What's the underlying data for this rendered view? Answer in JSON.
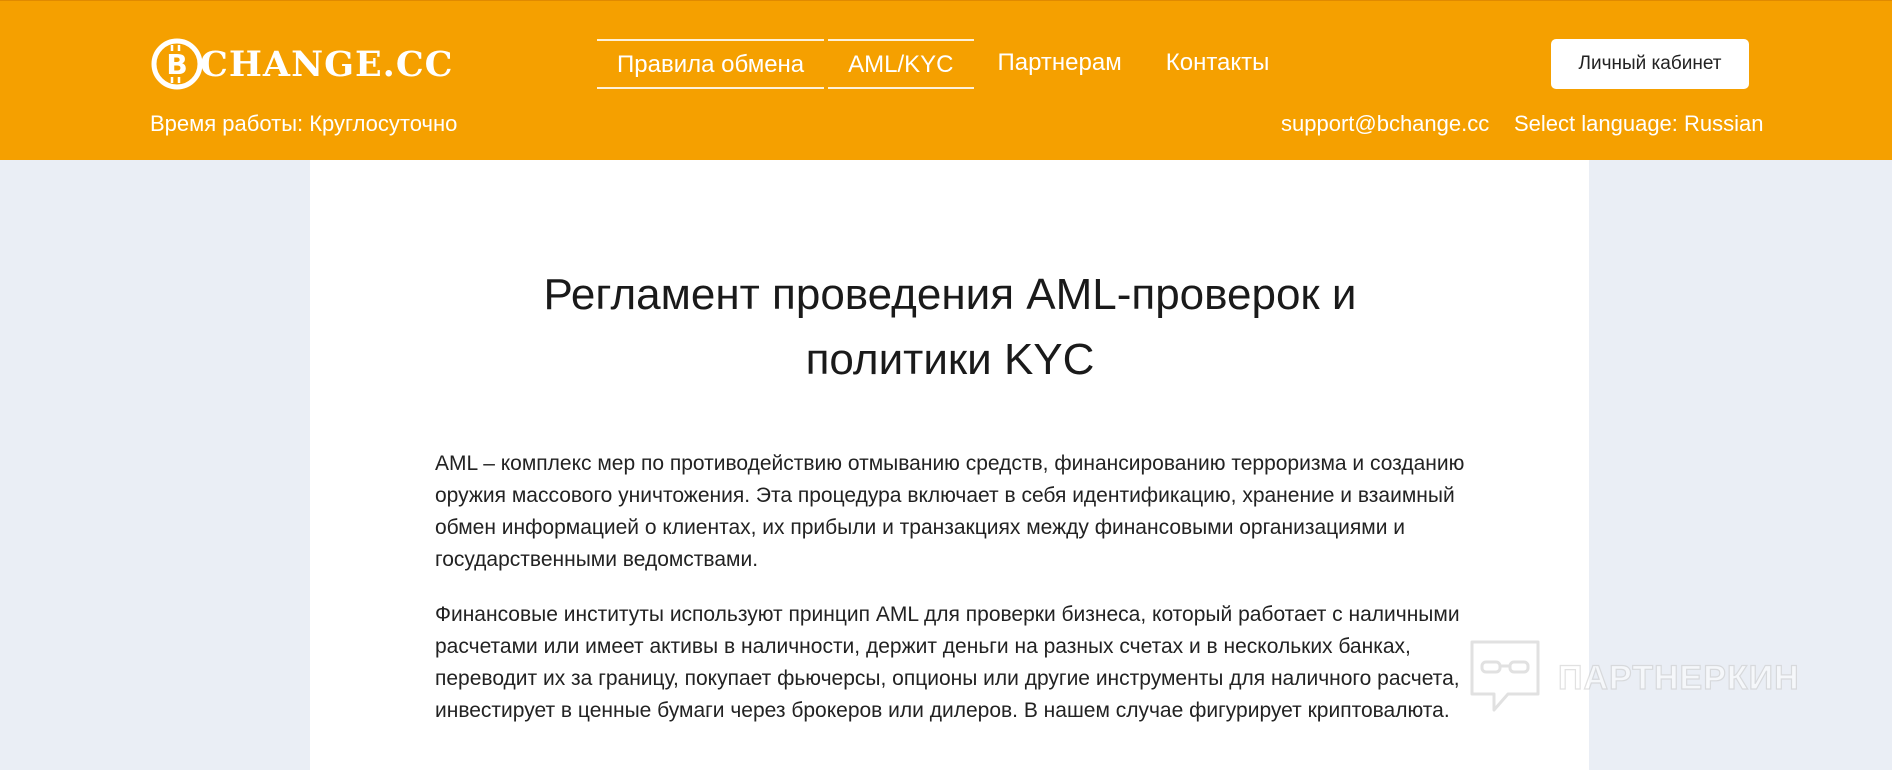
{
  "header": {
    "logo_text": "CHANGE.CC",
    "nav": [
      {
        "label": "Правила обмена"
      },
      {
        "label": "AML/KYC"
      },
      {
        "label": "Партнерам"
      },
      {
        "label": "Контакты"
      }
    ],
    "cabinet_label": "Личный кабинет",
    "work_hours": "Время работы: Круглосуточно",
    "support_email": "support@bchange.cc",
    "language": "Select language: Russian"
  },
  "content": {
    "title_line1": "Регламент проведения AML-проверок и",
    "title_line2": "политики KYC",
    "paragraphs": [
      "AML – комплекс мер по противодействию отмыванию средств, финансированию терроризма и созданию оружия массового уничтожения. Эта процедура включает в себя идентификацию, хранение и взаимный обмен информацией о клиентах, их прибыли и транзакциях между финансовыми организациями и государственными ведомствами.",
      "Финансовые институты используют принцип AML для проверки бизнеса, который работает с наличными расчетами или имеет активы в наличности, держит деньги на разных счетах и в нескольких банках, переводит их за границу, покупает фьючерсы, опционы или другие инструменты для наличного расчета, инвестирует в ценные бумаги через брокеров или дилеров. В нашем случае фигурирует криптовалюта."
    ]
  },
  "watermark": {
    "text": "ПАРТНЕРКИН"
  },
  "colors": {
    "header_bg": "#f5a000",
    "page_bg": "#eaeef5",
    "panel_bg": "#ffffff"
  }
}
